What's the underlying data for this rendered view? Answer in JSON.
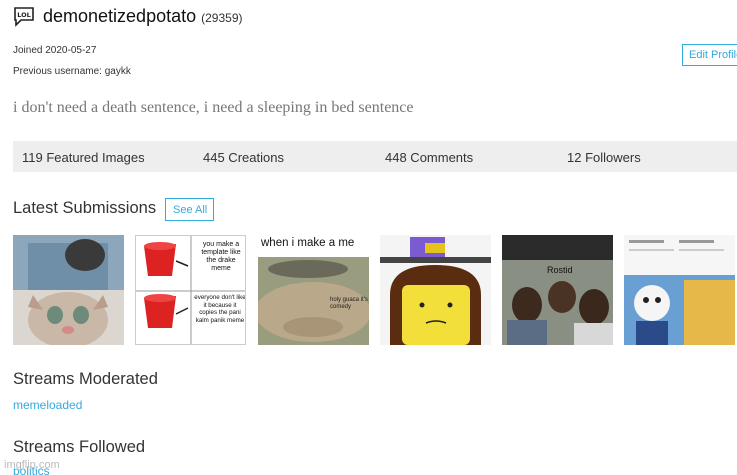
{
  "profile": {
    "username": "demonetizedpotato",
    "points": "(29359)",
    "joined": "Joined 2020-05-27",
    "previous_username": "Previous username: gaykk",
    "bio": "i don't need a death sentence, i need a sleeping in bed sentence",
    "edit_profile_label": "Edit Profile"
  },
  "stats": [
    {
      "label": "119 Featured Images"
    },
    {
      "label": "445 Creations"
    },
    {
      "label": "448 Comments"
    },
    {
      "label": "12 Followers"
    }
  ],
  "latest": {
    "title": "Latest Submissions",
    "see_all_label": "See All",
    "thumbnails": [
      {
        "name": "thumbnail-cat-meme"
      },
      {
        "name": "thumbnail-bucket-drake-meme",
        "text_top": "you make a template like the drake meme",
        "text_bottom": "everyone don't like it because it copies the pani kalm panik meme"
      },
      {
        "name": "thumbnail-when-i-make-a-meme",
        "caption": "when i make a me",
        "overlay": "holy guaca it's comedy"
      },
      {
        "name": "thumbnail-cartoon-face"
      },
      {
        "name": "thumbnail-roasted-meme",
        "caption": "Rostid"
      },
      {
        "name": "thumbnail-sans-meme"
      }
    ]
  },
  "streams_moderated": {
    "title": "Streams Moderated",
    "items": [
      "memeloaded"
    ]
  },
  "streams_followed": {
    "title": "Streams Followed",
    "items": [
      "politics"
    ]
  },
  "watermark": "imgflip.com",
  "colors": {
    "accent": "#33aadd",
    "stats_bg": "#eeeeee",
    "bio_text": "#777777"
  }
}
